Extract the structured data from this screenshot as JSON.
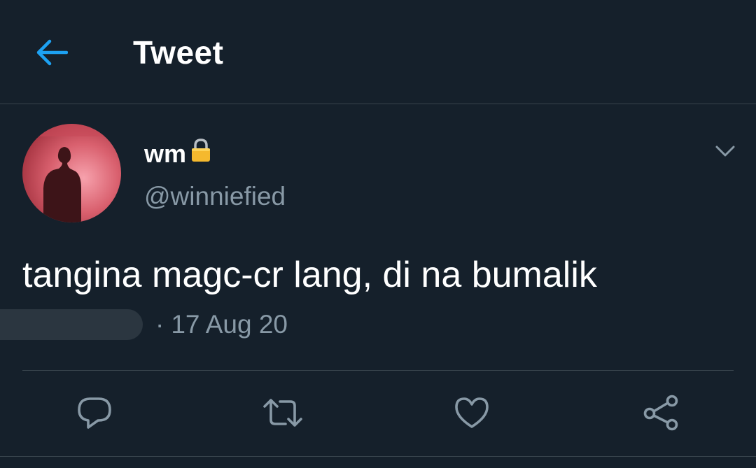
{
  "header": {
    "title": "Tweet",
    "back_icon": "arrow-left-icon"
  },
  "author": {
    "display_name": "wm",
    "handle": "@winniefied",
    "protected_icon": "lock-icon",
    "avatar": "profile-photo"
  },
  "tweet": {
    "text": "tangina magc-cr lang, di na bumalik",
    "time_redacted": true,
    "date": "17 Aug 20",
    "separator": "·"
  },
  "actions": [
    {
      "name": "reply",
      "icon": "speech-bubble-icon"
    },
    {
      "name": "retweet",
      "icon": "retweet-icon"
    },
    {
      "name": "like",
      "icon": "heart-icon"
    },
    {
      "name": "share",
      "icon": "share-icon"
    }
  ],
  "colors": {
    "background": "#15202b",
    "accent": "#1da1f2",
    "secondary_text": "#8899a6",
    "border": "#38444d"
  }
}
